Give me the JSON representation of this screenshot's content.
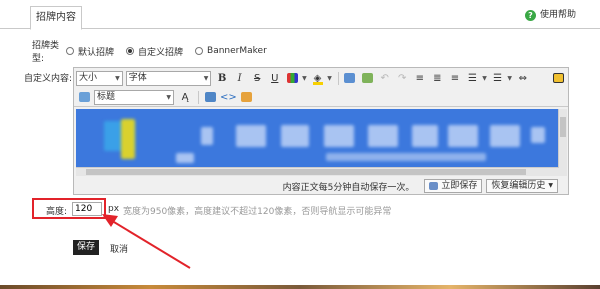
{
  "header": {
    "tab_label": "招牌内容",
    "help_label": "使用帮助",
    "help_icon": "question-circle-icon"
  },
  "type_row": {
    "label": "招牌类型:",
    "options": [
      {
        "label": "默认招牌",
        "selected": false
      },
      {
        "label": "自定义招牌",
        "selected": true
      },
      {
        "label": "BannerMaker",
        "selected": false
      }
    ]
  },
  "content_label": "自定义内容:",
  "toolbar": {
    "font_size": "大小",
    "font_family": "字体",
    "bold": "B",
    "italic": "I",
    "strike": "S",
    "underline": "U",
    "heading": "标题"
  },
  "status": {
    "autosave_message": "内容正文每5分钟自动保存一次。",
    "save_now_label": "立即保存",
    "restore_label": "恢复编辑历史"
  },
  "height_row": {
    "label": "高度:",
    "value": "120",
    "unit": "px",
    "hint": "宽度为950像素，高度建议不超过120像素，否则导航显示可能异常"
  },
  "actions": {
    "save_label": "保存",
    "cancel_label": "取消"
  },
  "colors": {
    "highlight_red": "#e2232a",
    "banner_blue": "#3c78dd",
    "save_button": "#222222",
    "help_green": "#3aa845"
  }
}
